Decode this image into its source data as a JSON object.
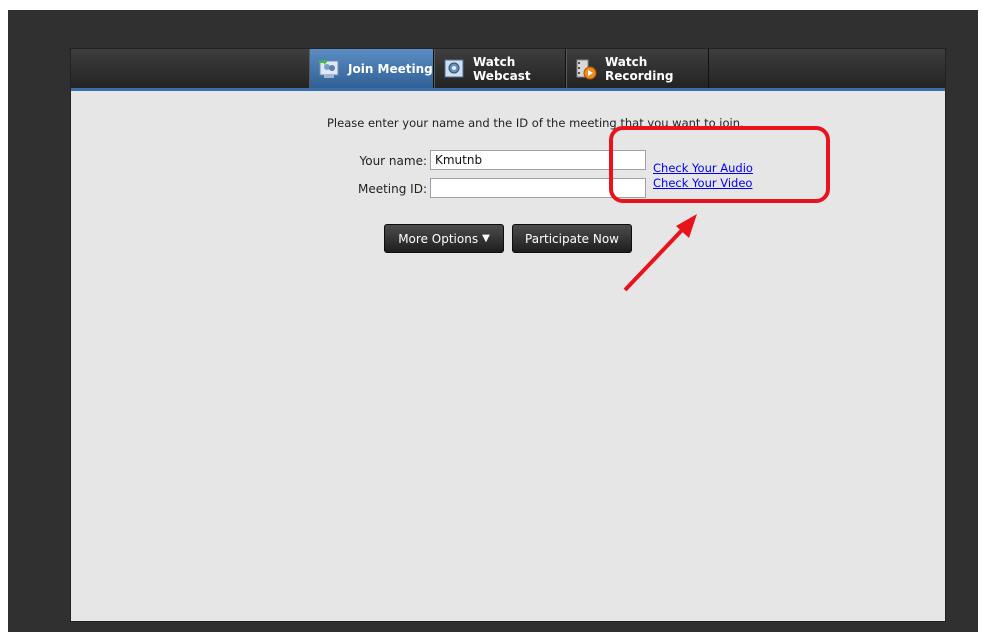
{
  "tabs": [
    {
      "label": "Join Meeting",
      "icon": "join-meeting-icon",
      "active": true
    },
    {
      "label": "Watch Webcast",
      "icon": "webcast-icon",
      "active": false
    },
    {
      "label": "Watch Recording",
      "icon": "recording-icon",
      "active": false
    }
  ],
  "form": {
    "instructions": "Please enter your name and the ID of the meeting that you want to join.",
    "name_label": "Your name:",
    "name_value": "Kmutnb",
    "meeting_label": "Meeting ID:",
    "meeting_value": ""
  },
  "links": {
    "check_audio": "Check Your Audio",
    "check_video": "Check Your Video"
  },
  "buttons": {
    "more_options": "More Options",
    "more_options_icon": "double-chevron-down-icon",
    "participate": "Participate Now"
  },
  "colors": {
    "active_tab": "#3d72ad",
    "accent_line": "#3a6ea8",
    "annotation": "#e8141c",
    "link": "#0000ee"
  }
}
